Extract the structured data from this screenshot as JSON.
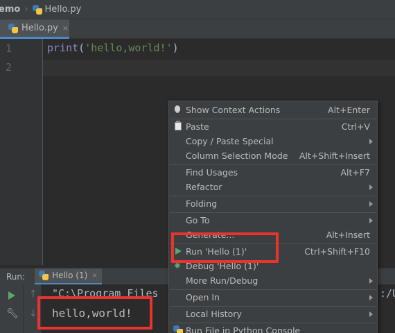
{
  "breadcrumb": {
    "project": "emo",
    "file": "Hello.py"
  },
  "editor_tab": {
    "label": "Hello.py",
    "close": "×"
  },
  "editor": {
    "line_numbers": [
      "1",
      "2"
    ],
    "code": {
      "func": "print",
      "open": "(",
      "string": "'hello,world!'",
      "close": ")"
    }
  },
  "run_panel": {
    "label": "Run:",
    "tab": "Hello (1)",
    "tab_close": "×",
    "console_cmd": "\"C:\\Program Files",
    "console_tail": ":/U",
    "console_output": "hello,world!"
  },
  "context_menu": {
    "items": [
      {
        "label": "Show Context Actions",
        "shortcut": "Alt+Enter"
      },
      {
        "label": "Paste",
        "shortcut": "Ctrl+V"
      },
      {
        "label": "Copy / Paste Special",
        "shortcut": ""
      },
      {
        "label": "Column Selection Mode",
        "shortcut": "Alt+Shift+Insert"
      },
      {
        "label": "Find Usages",
        "shortcut": "Alt+F7"
      },
      {
        "label": "Refactor",
        "shortcut": ""
      },
      {
        "label": "Folding",
        "shortcut": ""
      },
      {
        "label": "Go To",
        "shortcut": ""
      },
      {
        "label": "Generate...",
        "shortcut": "Alt+Insert"
      },
      {
        "label": "Run 'Hello (1)'",
        "shortcut": "Ctrl+Shift+F10"
      },
      {
        "label": "Debug 'Hello (1)'",
        "shortcut": ""
      },
      {
        "label": "More Run/Debug",
        "shortcut": ""
      },
      {
        "label": "Open In",
        "shortcut": ""
      },
      {
        "label": "Local History",
        "shortcut": ""
      },
      {
        "label": "Run File in Python Console",
        "shortcut": ""
      }
    ]
  },
  "colors": {
    "highlight": "#e8332f",
    "run_green": "#59a869",
    "string_green": "#6a8759"
  }
}
